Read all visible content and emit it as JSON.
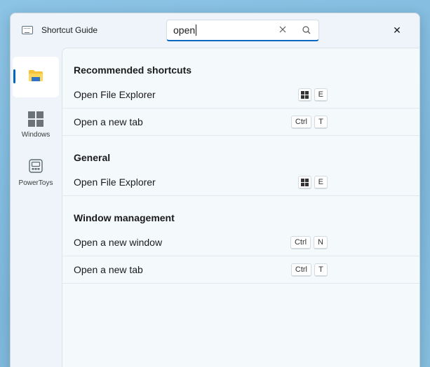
{
  "app": {
    "title": "Shortcut Guide"
  },
  "search": {
    "value": "open",
    "placeholder": ""
  },
  "close_label": "✕",
  "sidebar": {
    "items": [
      {
        "label": "",
        "icon": "file-explorer-icon",
        "selected": true
      },
      {
        "label": "Windows",
        "icon": "windows-logo-icon",
        "selected": false
      },
      {
        "label": "PowerToys",
        "icon": "powertoys-icon",
        "selected": false
      }
    ]
  },
  "sections": [
    {
      "title": "Recommended shortcuts",
      "rows": [
        {
          "label": "Open File Explorer",
          "keys": [
            "Win",
            "E"
          ]
        },
        {
          "label": "Open a new tab",
          "keys": [
            "Ctrl",
            "T"
          ]
        }
      ]
    },
    {
      "title": "General",
      "rows": [
        {
          "label": "Open File Explorer",
          "keys": [
            "Win",
            "E"
          ]
        }
      ]
    },
    {
      "title": "Window management",
      "rows": [
        {
          "label": "Open a new window",
          "keys": [
            "Ctrl",
            "N"
          ]
        },
        {
          "label": "Open a new tab",
          "keys": [
            "Ctrl",
            "T"
          ]
        }
      ]
    }
  ],
  "colors": {
    "accent": "#0067c0",
    "folder": "#f5c338"
  }
}
